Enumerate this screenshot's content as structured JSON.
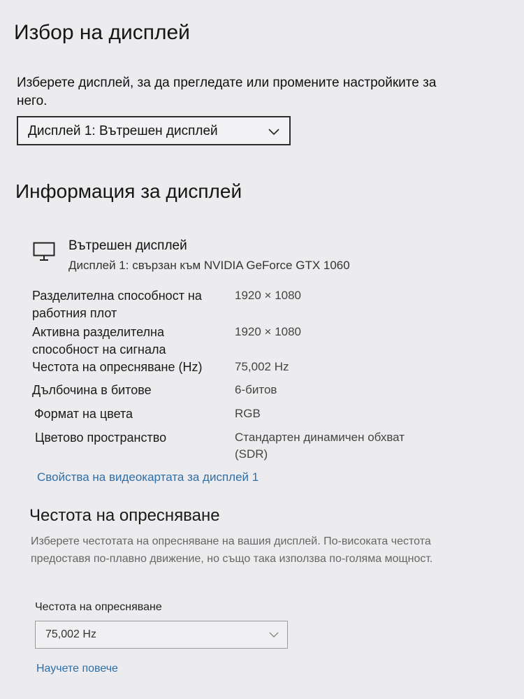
{
  "page_title": "Избор на дисплей",
  "select_description": "Изберете дисплей, за да прегледате или промените настройките за него.",
  "display_selector": {
    "value": "Дисплей 1: Вътрешен дисплей"
  },
  "info_heading": "Информация за дисплей",
  "display": {
    "name": "Вътрешен дисплей",
    "subtitle": "Дисплей 1: свързан към NVIDIA GeForce GTX 1060"
  },
  "info_rows": [
    {
      "label": "Разделителна способност на работния плот",
      "value": "1920 × 1080"
    },
    {
      "label": "Активна разделителна способност на сигнала",
      "value": "1920 × 1080"
    },
    {
      "label": "Честота на опресняване (Hz)",
      "value": "75,002 Hz"
    },
    {
      "label": "Дълбочина в битове",
      "value": "6-битов"
    },
    {
      "label": "Формат на цвета",
      "value": "RGB"
    },
    {
      "label": "Цветово пространство",
      "value": "Стандартен динамичен обхват (SDR)"
    }
  ],
  "adapter_link": "Свойства на видеокартата за дисплей 1",
  "refresh": {
    "heading": "Честота на опресняване",
    "description": "Изберете честотата на опресняване на вашия дисплей. По-високата честота предоставя по-плавно движение, но също така използва по-голяма мощност.",
    "field_label": "Честота на опресняване",
    "selected_value": "75,002 Hz",
    "learn_more": "Научете повече"
  }
}
